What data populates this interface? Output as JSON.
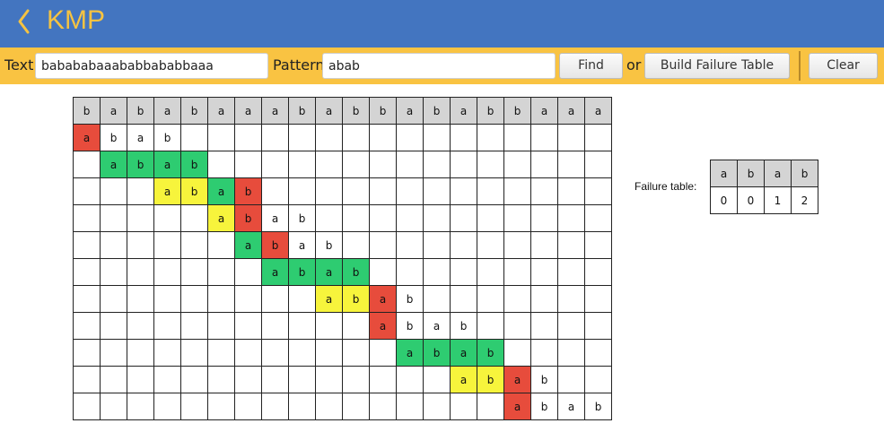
{
  "header": {
    "title": "KMP",
    "back_icon": "chevron-left-icon"
  },
  "toolbar": {
    "text_label": "Text",
    "text_value": "babababaaababbababbaaa",
    "pattern_label": "Pattern",
    "pattern_value": "abab",
    "find_label": "Find",
    "or_label": "or",
    "build_label": "Build Failure Table",
    "clear_label": "Clear"
  },
  "colors": {
    "header_bg": "#4375c0",
    "title": "#f5c342",
    "toolbar_bg": "#f9c342",
    "match": "#2ecc71",
    "partial": "#f7f43c",
    "mismatch": "#e74c3c",
    "header_cell": "#d4d4d4"
  },
  "grid": {
    "text_chars": [
      "b",
      "a",
      "b",
      "a",
      "b",
      "a",
      "a",
      "a",
      "b",
      "a",
      "b",
      "b",
      "a",
      "b",
      "a",
      "b",
      "b",
      "a",
      "a",
      "a"
    ],
    "rows": [
      {
        "offset": 0,
        "cells": [
          {
            "ch": "a",
            "s": "r"
          },
          {
            "ch": "b",
            "s": ""
          },
          {
            "ch": "a",
            "s": ""
          },
          {
            "ch": "b",
            "s": ""
          }
        ]
      },
      {
        "offset": 1,
        "cells": [
          {
            "ch": "a",
            "s": "g"
          },
          {
            "ch": "b",
            "s": "g"
          },
          {
            "ch": "a",
            "s": "g"
          },
          {
            "ch": "b",
            "s": "g"
          }
        ]
      },
      {
        "offset": 3,
        "cells": [
          {
            "ch": "a",
            "s": "y"
          },
          {
            "ch": "b",
            "s": "y"
          },
          {
            "ch": "a",
            "s": "g"
          },
          {
            "ch": "b",
            "s": "r"
          }
        ]
      },
      {
        "offset": 5,
        "cells": [
          {
            "ch": "a",
            "s": "y"
          },
          {
            "ch": "b",
            "s": "r"
          },
          {
            "ch": "a",
            "s": ""
          },
          {
            "ch": "b",
            "s": ""
          }
        ]
      },
      {
        "offset": 6,
        "cells": [
          {
            "ch": "a",
            "s": "g"
          },
          {
            "ch": "b",
            "s": "r"
          },
          {
            "ch": "a",
            "s": ""
          },
          {
            "ch": "b",
            "s": ""
          }
        ]
      },
      {
        "offset": 7,
        "cells": [
          {
            "ch": "a",
            "s": "g"
          },
          {
            "ch": "b",
            "s": "g"
          },
          {
            "ch": "a",
            "s": "g"
          },
          {
            "ch": "b",
            "s": "g"
          }
        ]
      },
      {
        "offset": 9,
        "cells": [
          {
            "ch": "a",
            "s": "y"
          },
          {
            "ch": "b",
            "s": "y"
          },
          {
            "ch": "a",
            "s": "r"
          },
          {
            "ch": "b",
            "s": ""
          }
        ]
      },
      {
        "offset": 11,
        "cells": [
          {
            "ch": "a",
            "s": "r"
          },
          {
            "ch": "b",
            "s": ""
          },
          {
            "ch": "a",
            "s": ""
          },
          {
            "ch": "b",
            "s": ""
          }
        ]
      },
      {
        "offset": 12,
        "cells": [
          {
            "ch": "a",
            "s": "g"
          },
          {
            "ch": "b",
            "s": "g"
          },
          {
            "ch": "a",
            "s": "g"
          },
          {
            "ch": "b",
            "s": "g"
          }
        ]
      },
      {
        "offset": 14,
        "cells": [
          {
            "ch": "a",
            "s": "y"
          },
          {
            "ch": "b",
            "s": "y"
          },
          {
            "ch": "a",
            "s": "r"
          },
          {
            "ch": "b",
            "s": ""
          }
        ]
      },
      {
        "offset": 16,
        "cells": [
          {
            "ch": "a",
            "s": "r"
          },
          {
            "ch": "b",
            "s": ""
          },
          {
            "ch": "a",
            "s": ""
          },
          {
            "ch": "b",
            "s": ""
          }
        ]
      }
    ]
  },
  "failure": {
    "label": "Failure table:",
    "pattern": [
      "a",
      "b",
      "a",
      "b"
    ],
    "values": [
      "0",
      "0",
      "1",
      "2"
    ]
  }
}
